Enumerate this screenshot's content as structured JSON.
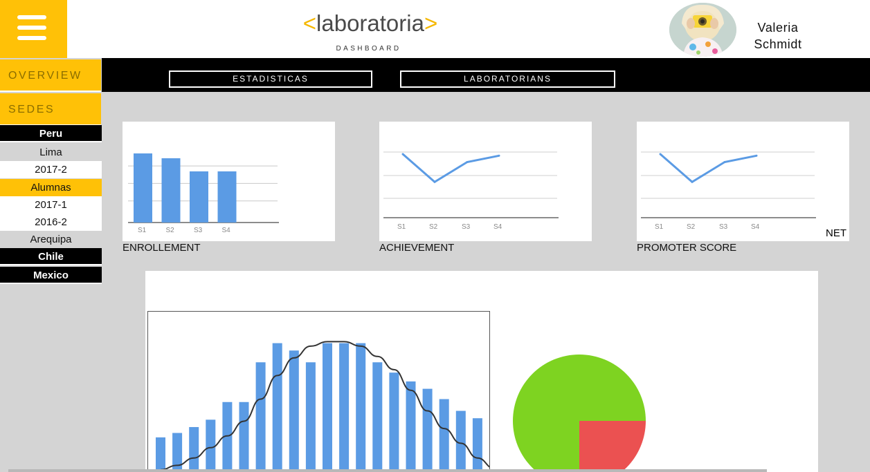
{
  "header": {
    "logo_open": "<",
    "logo_text": "laboratoria",
    "logo_close": ">",
    "logo_subtitle": "DASHBOARD",
    "user_first": "Valeria",
    "user_last": "Schmidt"
  },
  "sidebar": {
    "overview": "OVERVIEW",
    "sedes": "SEDES",
    "items": [
      "Peru",
      "Lima",
      "2017-2",
      "Alumnas",
      "2017-1",
      "2016-2",
      "Arequipa",
      "Chile",
      "Mexico"
    ]
  },
  "nav": {
    "estadisticas": "ESTADISTICAS",
    "laboratorians": "LABORATORIANS"
  },
  "cards": {
    "enrollment_label": "ENROLLEMENT",
    "achievement_label": "ACHIEVEMENT",
    "promoter_label": "PROMOTER SCORE",
    "net_label": "NET"
  },
  "colors": {
    "accent": "#ffc107",
    "bar": "#5b9be4",
    "pie_main": "#7ed321",
    "pie_slice": "#eb5151"
  },
  "chart_data": [
    {
      "type": "bar",
      "categories": [
        "S1",
        "S2",
        "S3",
        "S4"
      ],
      "values": [
        100,
        93,
        74,
        74
      ],
      "ylim": [
        0,
        110
      ],
      "grid": true
    },
    {
      "type": "line",
      "categories": [
        "S1",
        "S2",
        "S3",
        "S4"
      ],
      "values": [
        80,
        45,
        70,
        78
      ],
      "ylim": [
        0,
        100
      ],
      "grid": true
    },
    {
      "type": "line",
      "categories": [
        "S1",
        "S2",
        "S3",
        "S4"
      ],
      "values": [
        80,
        45,
        70,
        78
      ],
      "ylim": [
        0,
        100
      ],
      "grid": true
    },
    {
      "type": "bar",
      "values": [
        24,
        27,
        31,
        36,
        48,
        48,
        75,
        88,
        83,
        75,
        88,
        88,
        88,
        75,
        68,
        62,
        57,
        50,
        42,
        37,
        31
      ],
      "curve": [
        2,
        5,
        10,
        17,
        25,
        35,
        50,
        66,
        78,
        86,
        89,
        89,
        86,
        79,
        70,
        56,
        42,
        30,
        20,
        10,
        3
      ],
      "ylim": [
        0,
        100
      ],
      "grid": false
    },
    {
      "type": "pie",
      "slices": [
        {
          "value": 75,
          "color": "#7ed321"
        },
        {
          "value": 25,
          "color": "#eb5151"
        }
      ]
    }
  ]
}
